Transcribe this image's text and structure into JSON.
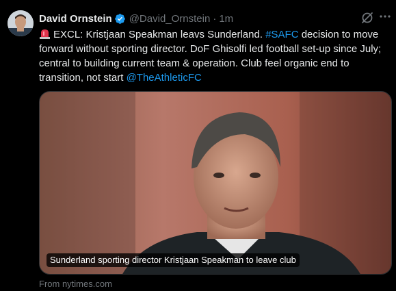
{
  "author": {
    "name": "David Ornstein",
    "handle": "@David_Ornstein",
    "separator": "·",
    "time": "1m"
  },
  "tweet": {
    "text_1": "EXCL: Kristjaan Speakman leavs Sunderland. ",
    "hashtag": "#SAFC",
    "text_2": " decision to move forward without sporting director. DoF Ghisolfi led football set-up since July; central to building current team & operation. Club feel organic end to transition, not start ",
    "mention": "@TheAthleticFC"
  },
  "card": {
    "caption": "Sunderland sporting director Kristjaan Speakman to leave club",
    "source": "From nytimes.com"
  },
  "colors": {
    "background": "#000000",
    "text": "#e7e9ea",
    "muted": "#71767b",
    "link": "#1d9bf0"
  },
  "icons": [
    "siren-icon",
    "verified-badge-icon",
    "grok-icon",
    "more-icon",
    "avatar"
  ]
}
